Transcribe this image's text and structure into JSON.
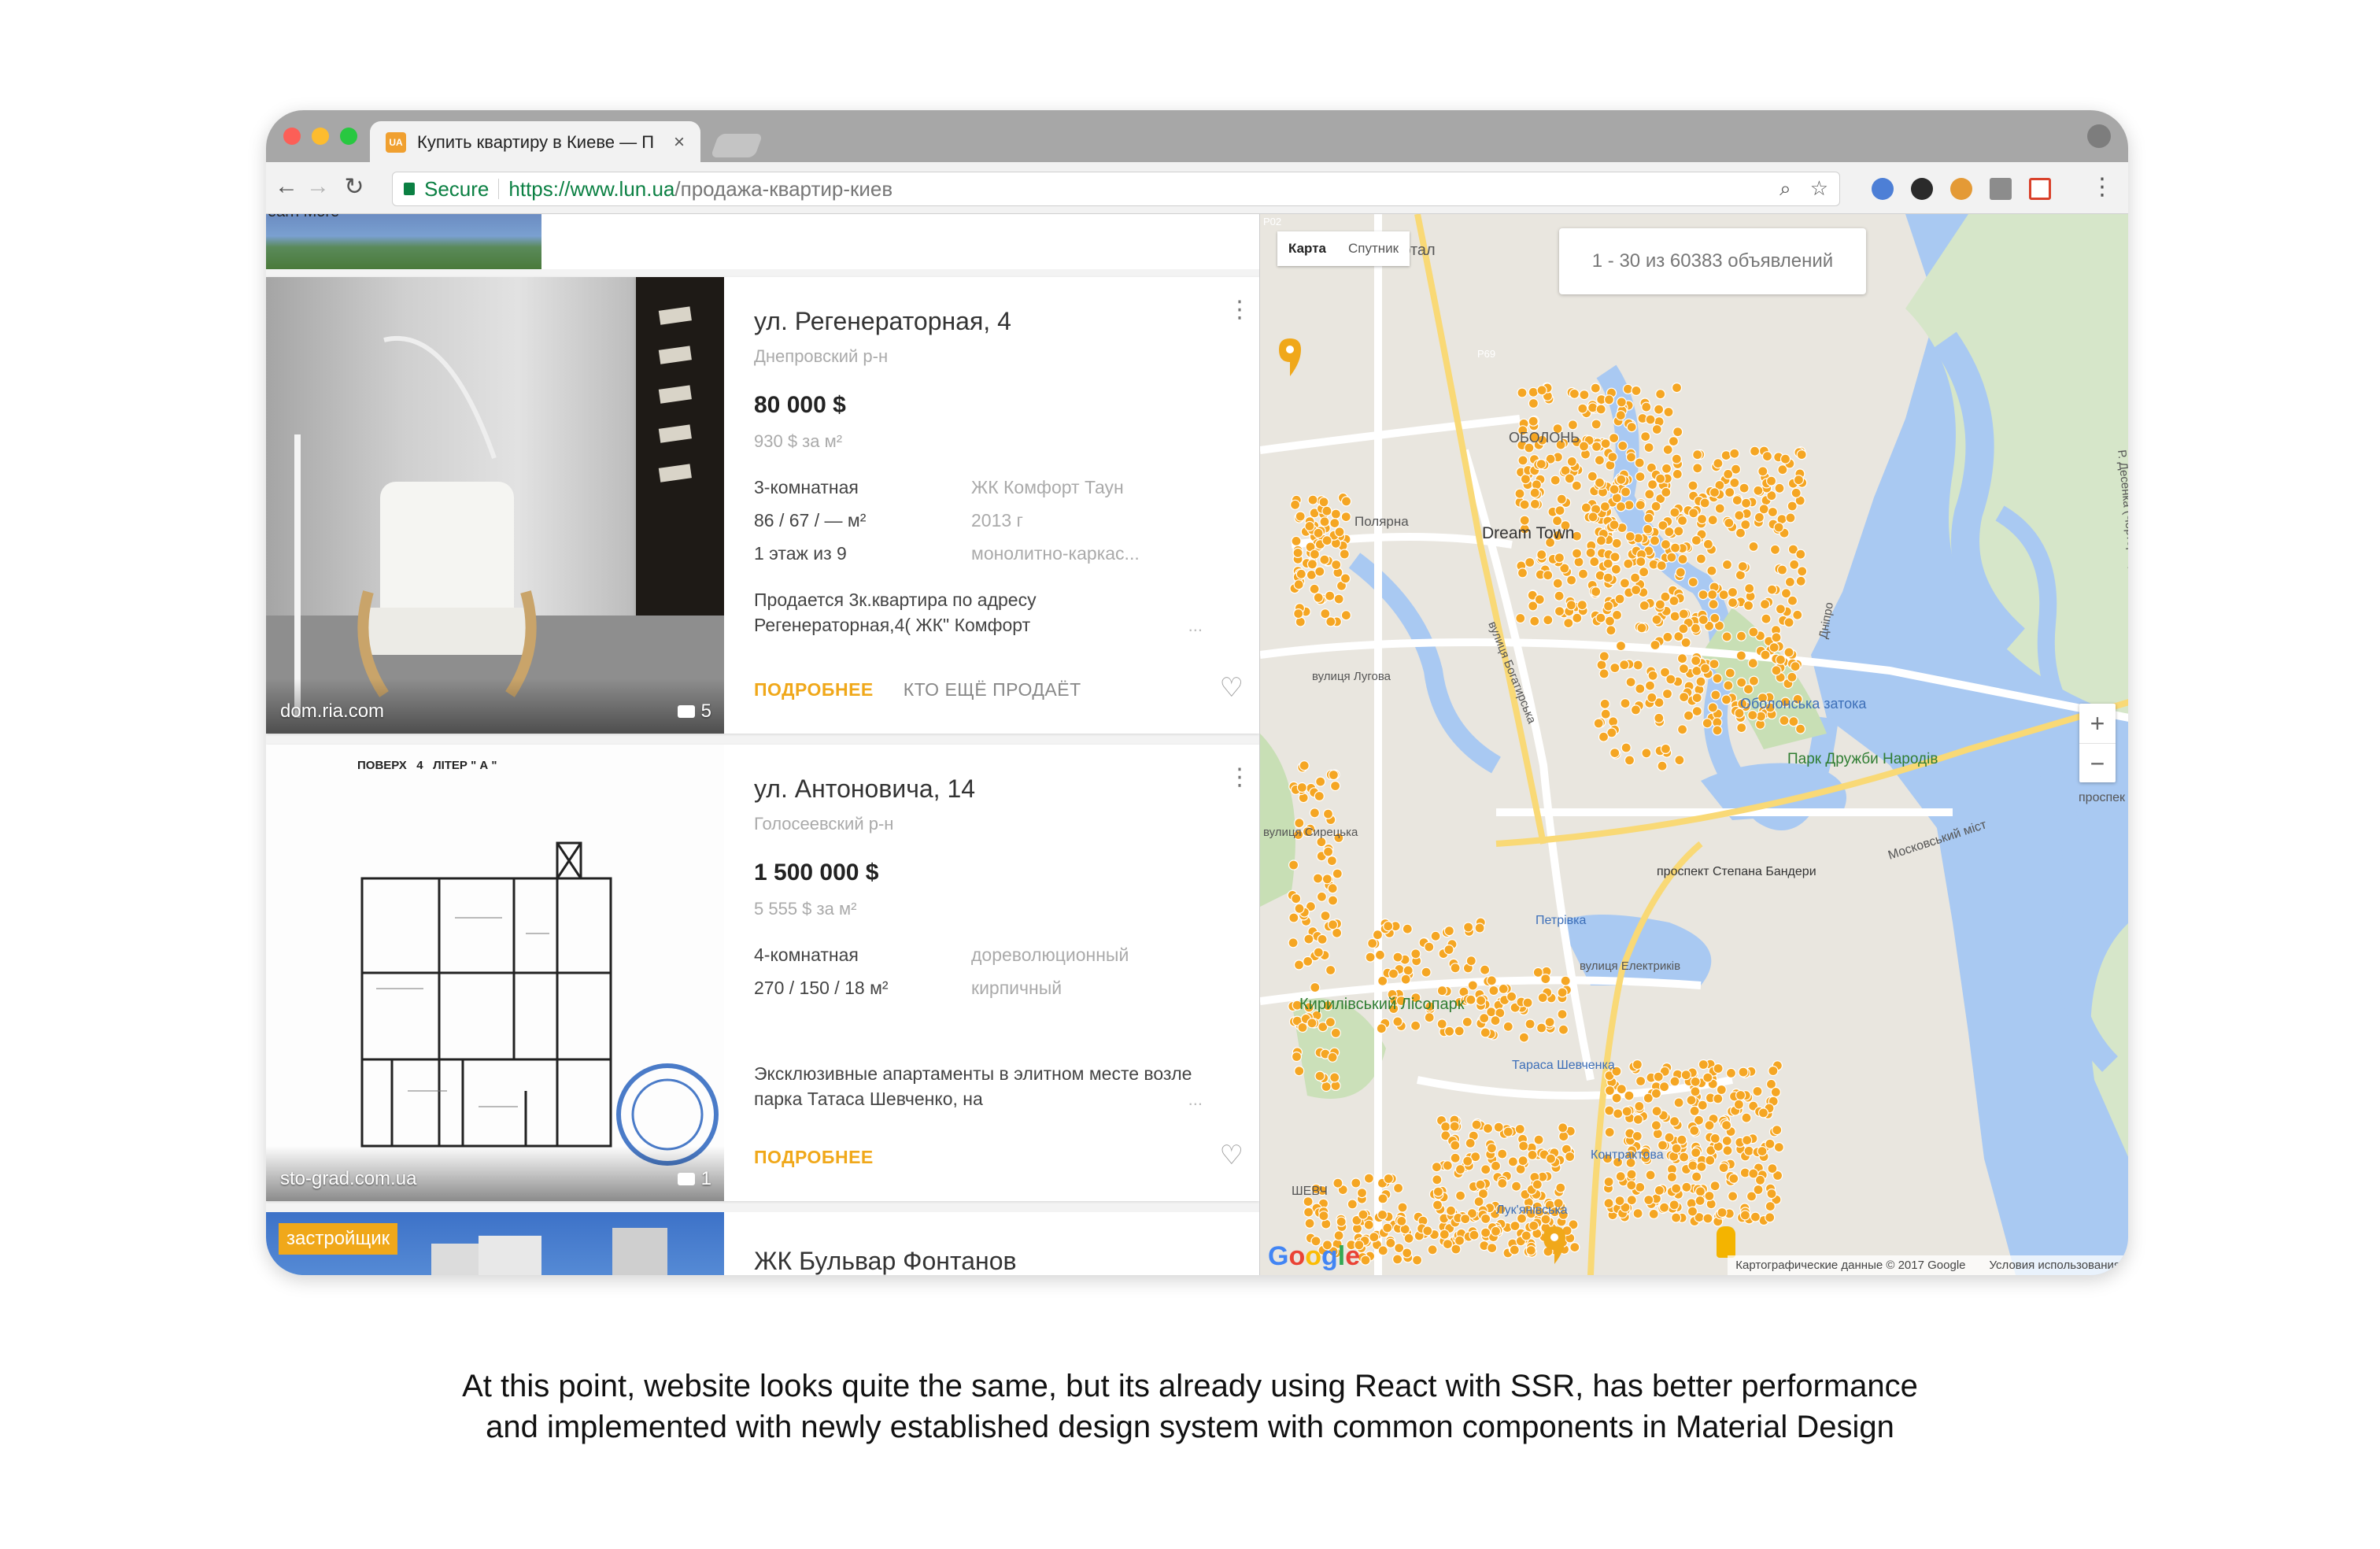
{
  "browser": {
    "tab_title": "Купить квартиру в Киеве — П",
    "tab_favicon": "UA",
    "tab_close": "×",
    "secure_label": "Secure",
    "url_scheme": "https://",
    "url_host": "www.lun.ua",
    "url_path": "/продажа-квартир-киев",
    "icons": [
      "back-icon",
      "forward-icon",
      "reload-icon",
      "lock-icon",
      "zoom-icon",
      "star-icon",
      "menu-icon"
    ]
  },
  "ad": {
    "learn_more": "earn More"
  },
  "listings": [
    {
      "title": "ул. Регенераторная, 4",
      "district": "Днепровский р-н",
      "price": "80 000 $",
      "price_per_m2": "930 $ за м²",
      "specs": [
        [
          "3-комнатная",
          "ЖК Комфорт Таун"
        ],
        [
          "86 / 67 / — м²",
          "2013 г"
        ],
        [
          "1 этаж из 9",
          "монолитно-каркас..."
        ]
      ],
      "description": "Продается 3к.квартира по адресу Регенераторная,4( ЖК\" Комфорт",
      "more_dots": "...",
      "action_primary": "ПОДРОБНЕЕ",
      "action_secondary": "КТО ЕЩЁ ПРОДАЁТ",
      "image_source": "dom.ria.com",
      "photo_count": "5"
    },
    {
      "title": "ул. Антоновича, 14",
      "district": "Голосеевский р-н",
      "price": "1 500 000 $",
      "price_per_m2": "5 555 $ за м²",
      "specs": [
        [
          "4-комнатная",
          "дореволюционный"
        ],
        [
          "270 / 150 / 18 м²",
          "кирпичный"
        ]
      ],
      "description": "Эксклюзивные апартаменты в элитном месте возле парка Татаса Шевченко, на",
      "more_dots": "...",
      "action_primary": "ПОДРОБНЕЕ",
      "image_source": "sto-grad.com.ua",
      "photo_count": "1",
      "plan_header": "ПОВЕРХ   4   ЛІТЕР \" А \""
    },
    {
      "title": "ЖК Бульвар Фонтанов",
      "badge": "застройщик"
    }
  ],
  "map": {
    "type_map": "Карта",
    "type_satellite": "Спутник",
    "count_label": "1 - 30 из 60383 объявлений",
    "zoom_in": "+",
    "zoom_out": "−",
    "attribution": "Картографические данные © 2017 Google",
    "terms": "Условия использования",
    "labels": {
      "obolon": "ОБОЛОНЬ",
      "poliarna": "Полярна",
      "dream": "Dream Town",
      "lugova": "вулиця Лугова",
      "bogatyrska": "вулиця Богатирська",
      "druzhby": "Парк Дружби Народів",
      "obolonska": "Оболонська затока",
      "bandery": "проспект Степана Бандери",
      "moskovskyi": "Московський міст",
      "petrivka": "Петрівка",
      "elektrykiv": "вулиця Електриків",
      "kyrylivskyi": "Кирилівський Лісопарк",
      "shevchenka": "Тараса Шевченка",
      "kontraktova": "Контрактова",
      "lukianivska": "Лук'янівська",
      "kvartal": "квартал",
      "p69": "P69",
      "p02": "P02",
      "desna": "Р. Десенка (Чорторой)",
      "dnipro": "Дніпро",
      "syrets": "вулиця Сирецька",
      "prospekt": "проспек",
      "lukianivka_short": "ШЕВЧ"
    }
  },
  "caption": {
    "line1": "At this point, website looks quite the same, but its already using React with SSR, has better performance",
    "line2": "and implemented with newly established design system with common components in Material Design"
  }
}
